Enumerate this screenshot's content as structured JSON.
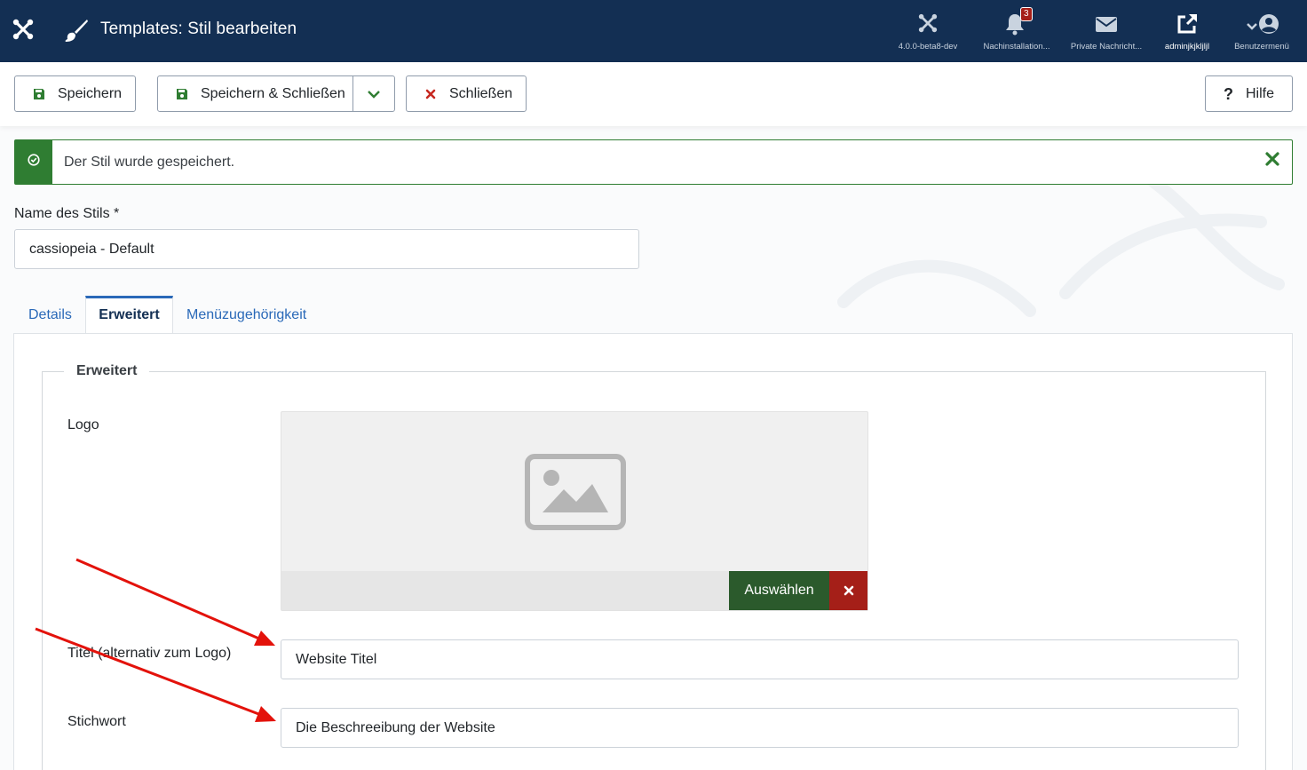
{
  "header": {
    "title": "Templates: Stil bearbeiten",
    "items": [
      {
        "label": "4.0.0-beta8-dev",
        "icon": "joomla-icon"
      },
      {
        "label": "Nachinstallation...",
        "icon": "bell-icon",
        "badge": "3"
      },
      {
        "label": "Private Nachricht...",
        "icon": "envelope-icon"
      },
      {
        "label": "adminjkjkljljl",
        "icon": "external-link-icon"
      },
      {
        "label": "Benutzermenü",
        "icon": "user-icon"
      }
    ]
  },
  "toolbar": {
    "save_label": "Speichern",
    "save_close_label": "Speichern & Schließen",
    "close_label": "Schließen",
    "help_label": "Hilfe"
  },
  "alert": {
    "message": "Der Stil wurde gespeichert."
  },
  "form": {
    "name_label": "Name des Stils *",
    "name_value": "cassiopeia - Default"
  },
  "tabs": [
    {
      "label": "Details"
    },
    {
      "label": "Erweitert"
    },
    {
      "label": "Menüzugehörigkeit"
    }
  ],
  "active_tab": "Erweitert",
  "advanced": {
    "legend": "Erweitert",
    "logo_label": "Logo",
    "select_label": "Auswählen",
    "title_label": "Titel (alternativ zum Logo)",
    "title_value": "Website Titel",
    "keyword_label": "Stichwort",
    "keyword_value": "Die Beschreeibung der Website"
  },
  "colors": {
    "header_bg": "#132f53",
    "success": "#2f7d32",
    "danger": "#a51f18",
    "select_button": "#2b5a2c",
    "annotation_arrow": "#e3120b"
  }
}
